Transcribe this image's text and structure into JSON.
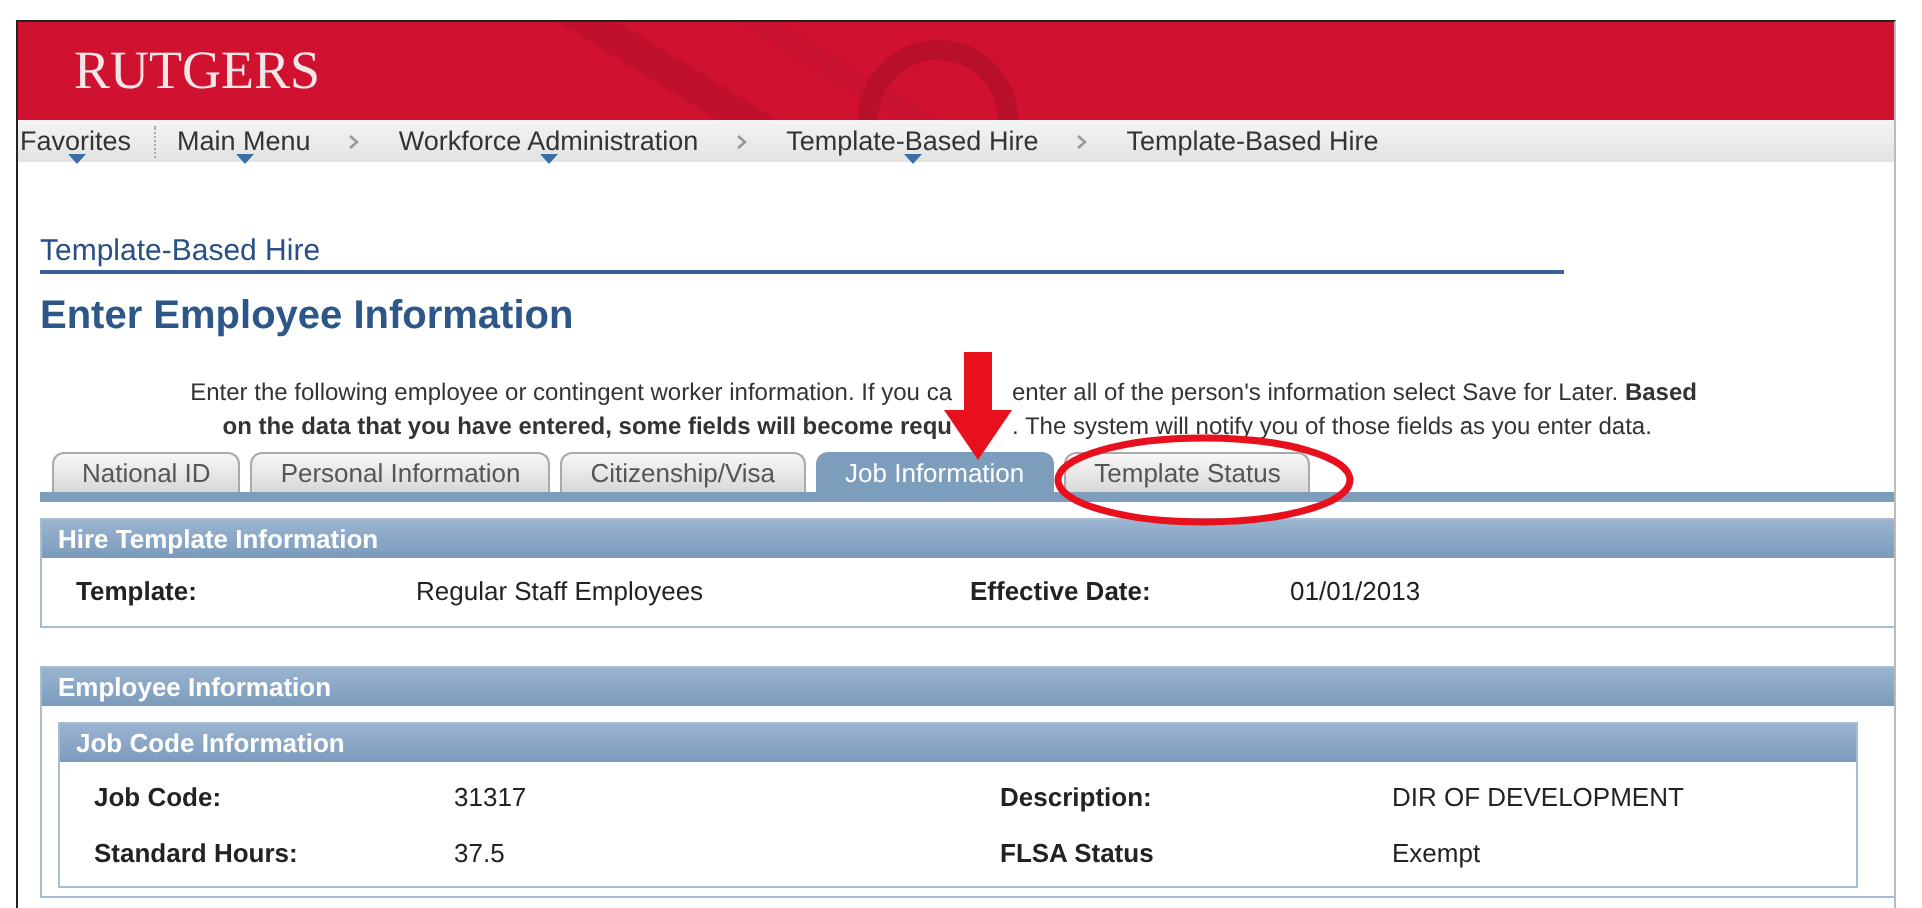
{
  "header": {
    "logo": "RUTGERS"
  },
  "breadcrumbs": [
    {
      "label": "Favorites",
      "dropdown": true
    },
    {
      "label": "Main Menu",
      "dropdown": true
    },
    {
      "label": "Workforce Administration",
      "dropdown": true
    },
    {
      "label": "Template-Based Hire",
      "dropdown": true
    },
    {
      "label": "Template-Based Hire",
      "dropdown": false
    }
  ],
  "component_title": "Template-Based Hire",
  "heading": "Enter Employee Information",
  "intro": {
    "line_1_left": "Enter the following employee or contingent worker information. If you ca",
    "line_1_right": "enter all of the person's information select Save for Later. **Based**",
    "line_2_left": "**on the data that you have entered, some fields will become requ**",
    "line_2_right": ". The system will notify you of those fields as you enter data."
  },
  "tabs": [
    {
      "label": "National ID",
      "selected": false,
      "circled": false
    },
    {
      "label": "Personal Information",
      "selected": false,
      "circled": false
    },
    {
      "label": "Citizenship/Visa",
      "selected": false,
      "circled": false
    },
    {
      "label": "Job Information",
      "selected": true,
      "circled": false
    },
    {
      "label": "Template Status",
      "selected": false,
      "circled": true
    }
  ],
  "hire_template": {
    "title": "Hire Template Information",
    "fields": [
      {
        "label": "Template:",
        "value": "Regular Staff Employees"
      },
      {
        "label": "Effective Date:",
        "value": "01/01/2013"
      }
    ]
  },
  "employee_information": {
    "title": "Employee Information",
    "job_code": {
      "title": "Job Code Information",
      "rows": [
        [
          {
            "label": "Job Code:",
            "value": "31317"
          },
          {
            "label": "Description:",
            "value": "DIR OF DEVELOPMENT"
          }
        ],
        [
          {
            "label": "Standard Hours:",
            "value": "37.5"
          },
          {
            "label": "FLSA Status",
            "value": "Exempt"
          }
        ]
      ]
    }
  }
}
